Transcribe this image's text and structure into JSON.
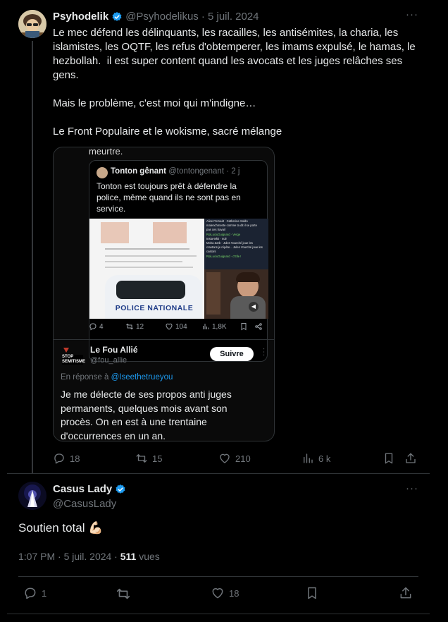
{
  "tweet1": {
    "display_name": "Psyhodelik",
    "handle": "@Psyhodelikus",
    "date": "· 5 juil. 2024",
    "text": "Le mec défend les délinquants, les racailles, les antisémites, la charia, les islamistes, les OQTF, les refus d'obtemperer, les imams expulsé, le hamas, le hezbollah.  il est super content quand les avocats et les juges relâches ses gens.\n\nMais le problème, c'est moi qui m'indigne…\n\nLe Front Populaire et le wokisme, sacré mélange",
    "actions": {
      "replies": "18",
      "retweets": "15",
      "likes": "210",
      "views": "6 k"
    }
  },
  "media": {
    "top_text": "meurtre.",
    "quote": {
      "name": "Tonton gênant",
      "handle": "@tontongenant · 2 j",
      "text": "Tonton est toujours prêt à défendre la police, même quand ils ne sont pas en service.",
      "car_text": "POLICE NATIONALE",
      "chat_lines": [
        "Alice Perrault · Catherine Soldo",
        "malenchmente comme ta dit il se porte",
        "pas ces travail",
        "RoiLuciuGuignard · Verge",
        "Insta-tekk · nulr",
        "Moha Zarb · Jules Vourché joue les",
        "cravtons je répète... Jules Vourché joue les",
        "castors",
        "RoiLuciuGuignard · c'Elle !"
      ]
    },
    "quote_actions": {
      "replies": "4",
      "retweets": "12",
      "likes": "104",
      "views": "1,8K"
    },
    "reply": {
      "name": "Le Fou Allié",
      "handle": "@fou_allie",
      "follow_label": "Suivre",
      "in_reply_prefix": "En réponse à",
      "in_reply_handle": "@Iseethetrueyou",
      "text": "Je me délecte de ses propos anti juges permanents, quelques mois avant son procès. On en est à une trentaine d'occurrences en un an.",
      "logo_text": "STOP SEMITISME"
    }
  },
  "tweet2": {
    "display_name": "Casus Lady",
    "handle": "@CasusLady",
    "text": "Soutien total 💪🏻",
    "time": "1:07 PM · 5 juil. 2024 ·",
    "views_count": "511",
    "views_label": "vues",
    "actions": {
      "replies": "1",
      "likes": "18"
    }
  },
  "colors": {
    "accent": "#1d9bf0",
    "muted": "#71767b",
    "border": "#2f3336"
  }
}
